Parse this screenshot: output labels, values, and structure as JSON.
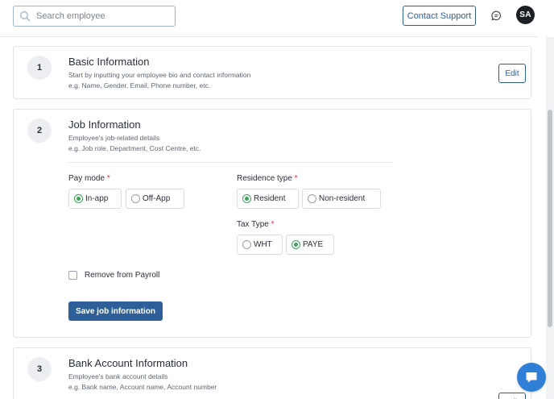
{
  "header": {
    "search_placeholder": "Search employee",
    "contact_support_label": "Contact Support",
    "avatar_initials": "SA"
  },
  "sections": {
    "basic": {
      "step": "1",
      "title": "Basic Information",
      "desc_line1": "Start by inputting your employee bio and contact information",
      "desc_line2": "e.g. Name, Gender, Email, Phone number, etc.",
      "edit_label": "Edit"
    },
    "job": {
      "step": "2",
      "title": "Job Information",
      "desc_line1": "Employee's job-related details",
      "desc_line2": "e.g. Job role, Department, Cost Centre, etc.",
      "pay_mode": {
        "label": "Pay mode",
        "required_mark": "*",
        "options": [
          "In-app",
          "Off-App"
        ],
        "selected": "In-app"
      },
      "residence_type": {
        "label": "Residence type",
        "required_mark": "*",
        "options": [
          "Resident",
          "Non-resident"
        ],
        "selected": "Resident"
      },
      "tax_type": {
        "label": "Tax Type",
        "required_mark": "*",
        "options": [
          "WHT",
          "PAYE"
        ],
        "selected": "PAYE"
      },
      "remove_from_payroll_label": "Remove from Payroll",
      "remove_from_payroll_checked": false,
      "save_label": "Save job information"
    },
    "bank": {
      "step": "3",
      "title": "Bank Account Information",
      "desc_line1": "Employee's bank account details",
      "desc_line2": "e.g. Bank name, Account name, Account number",
      "edit_label": "Edit"
    }
  },
  "colors": {
    "primary": "#2f5f98",
    "radio_selected": "#3aa55a",
    "required": "#d9333f",
    "chat_fab": "#2f7fd6"
  }
}
